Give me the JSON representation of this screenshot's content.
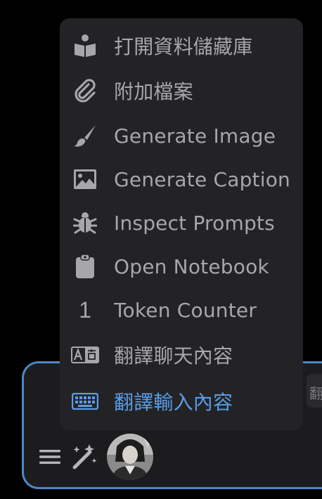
{
  "colors": {
    "background": "#000000",
    "menu_bg": "#232325",
    "input_bg": "#1c1c1e",
    "input_border": "#4f86c6",
    "text": "#a7a7a9",
    "active": "#5b9ce6"
  },
  "menu": {
    "items": [
      {
        "label": "打開資料儲藏庫",
        "icon": "book-reader-icon"
      },
      {
        "label": "附加檔案",
        "icon": "paperclip-icon"
      },
      {
        "label": "Generate Image",
        "icon": "paintbrush-icon"
      },
      {
        "label": "Generate Caption",
        "icon": "image-icon"
      },
      {
        "label": "Inspect Prompts",
        "icon": "bug-icon"
      },
      {
        "label": "Open Notebook",
        "icon": "clipboard-icon"
      },
      {
        "label": "Token Counter",
        "icon": "digit-one-icon",
        "icon_text": "1"
      },
      {
        "label": "翻譯聊天內容",
        "icon": "translate-icon"
      },
      {
        "label": "翻譯輸入內容",
        "icon": "keyboard-icon",
        "active": true
      }
    ]
  },
  "input_bar": {
    "send_peek_text": "翻",
    "options_icon": "hamburger-menu-icon",
    "magic_icon": "magic-wand-icon",
    "avatar": "character-avatar"
  }
}
